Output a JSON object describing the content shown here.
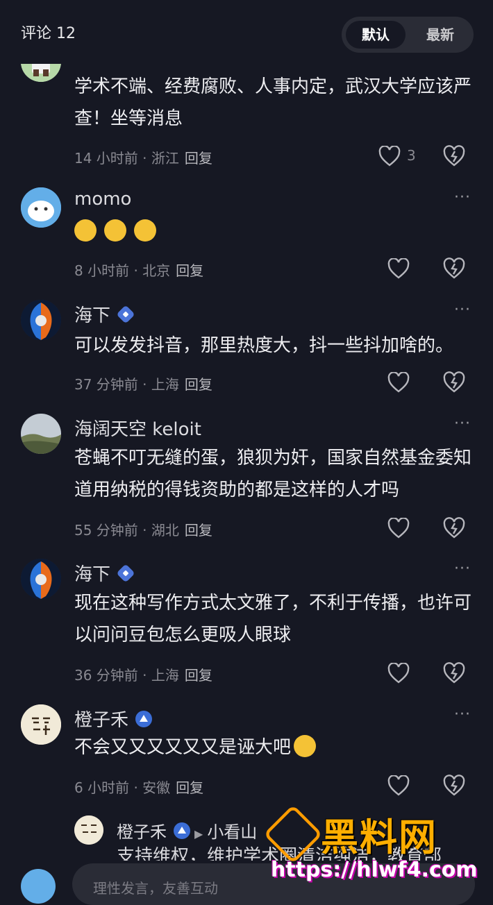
{
  "header": {
    "title": "评论 12",
    "sort_default": "默认",
    "sort_latest": "最新"
  },
  "comments": [
    {
      "user": "",
      "badge": "none",
      "text": "学术不端、经费腐败、人事内定，武汉大学应该严查！坐等消息",
      "time": "14 小时前",
      "location": "浙江",
      "reply": "回复",
      "likes": "3"
    },
    {
      "user": "momo",
      "badge": "none",
      "text": "",
      "emoji_count": 3,
      "time": "8 小时前",
      "location": "北京",
      "reply": "回复",
      "likes": ""
    },
    {
      "user": "海下",
      "badge": "blue",
      "text": "可以发发抖音，那里热度大，抖一些抖加啥的。",
      "time": "37 分钟前",
      "location": "上海",
      "reply": "回复",
      "likes": ""
    },
    {
      "user": "海阔天空 keloit",
      "badge": "none",
      "text": "苍蝇不叮无缝的蛋，狼狈为奸，国家自然基金委知道用纳税的得钱资助的都是这样的人才吗",
      "time": "55 分钟前",
      "location": "湖北",
      "reply": "回复",
      "likes": ""
    },
    {
      "user": "海下",
      "badge": "blue",
      "text": "现在这种写作方式太文雅了，不利于传播，也许可以问问豆包怎么更吸人眼球",
      "time": "36 分钟前",
      "location": "上海",
      "reply": "回复",
      "likes": ""
    },
    {
      "user": "橙子禾",
      "badge": "gold",
      "text": "不会又又又又又又是诬大吧",
      "time": "6 小时前",
      "location": "安徽",
      "reply": "回复",
      "likes": ""
    }
  ],
  "sub_reply": {
    "user": "橙子禾",
    "reply_to": "小看山",
    "text": "支持维权，维护学术圈清洁纯洁，教育部"
  },
  "input": {
    "placeholder": "理性发言，友善互动"
  },
  "watermark": {
    "title": "黑料网",
    "url": "https://hlwf4.com"
  },
  "colors": {
    "background": "#161823",
    "text": "#e8e8ea",
    "muted": "#8a8a92",
    "watermark": "#ffae00"
  }
}
